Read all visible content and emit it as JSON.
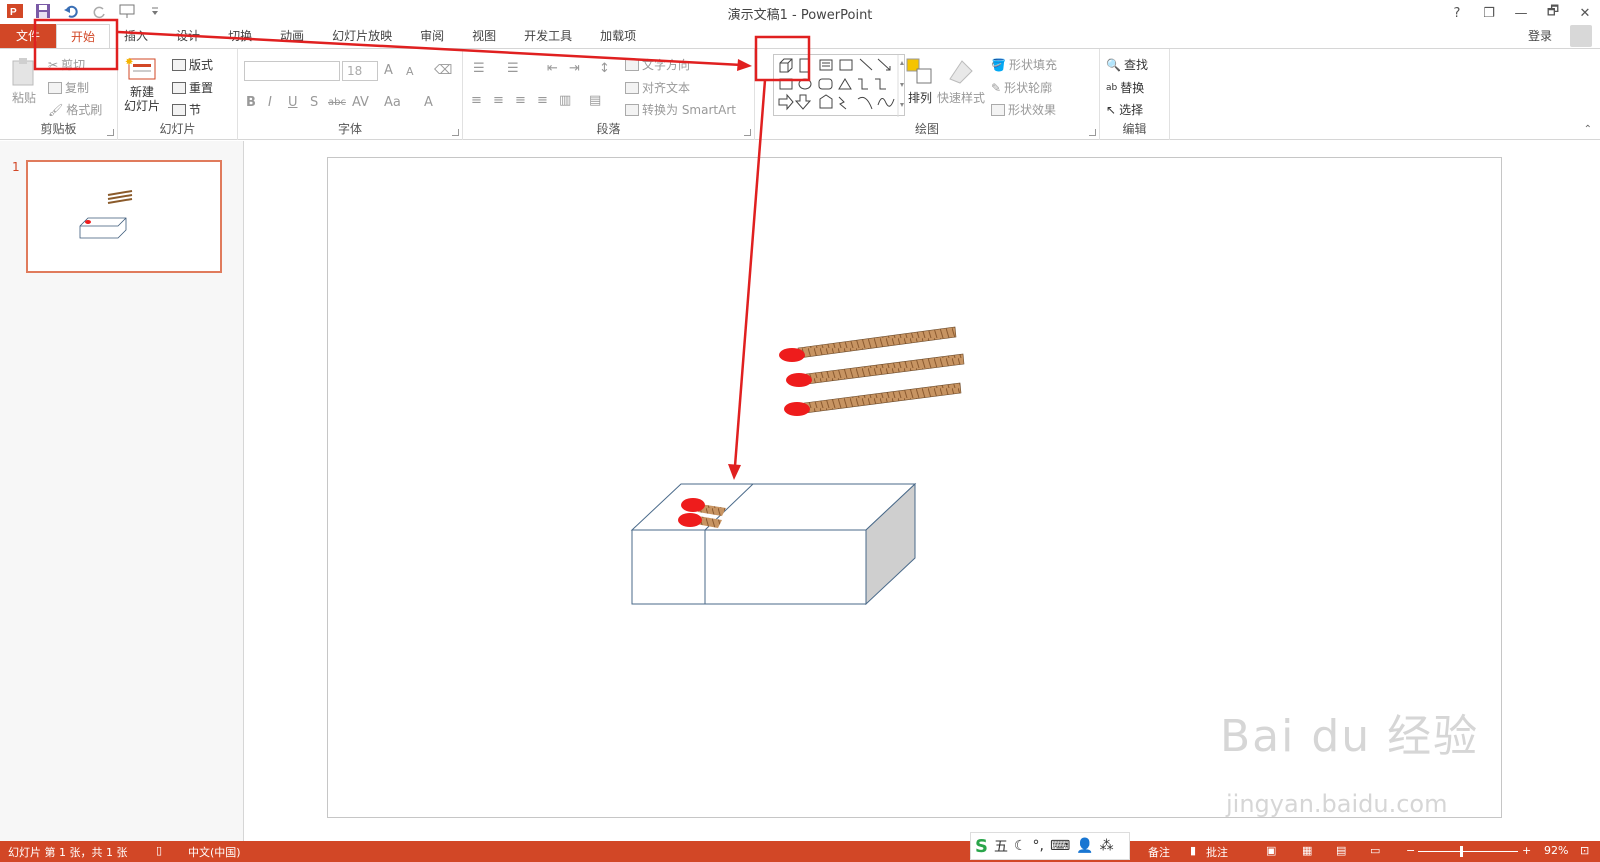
{
  "window": {
    "title": "演示文稿1 - PowerPoint"
  },
  "qat": {
    "icons": [
      "powerpoint-logo-icon",
      "save-icon",
      "undo-icon",
      "redo-icon",
      "presentation-icon",
      "customize-qat-icon"
    ]
  },
  "controls": {
    "help": "?",
    "restore": "❐",
    "minimize": "—",
    "maximize": "🗗",
    "close": "✕"
  },
  "tabs": [
    "文件",
    "开始",
    "插入",
    "设计",
    "切换",
    "动画",
    "幻灯片放映",
    "审阅",
    "视图",
    "开发工具",
    "加载项"
  ],
  "account": {
    "login": "登录"
  },
  "ribbon": {
    "clipboard": {
      "label": "剪贴板",
      "paste": "粘贴",
      "cut": "剪切",
      "copy": "复制",
      "format_painter": "格式刷"
    },
    "slides": {
      "label": "幻灯片",
      "new_slide_1": "新建",
      "new_slide_2": "幻灯片",
      "layout": "版式",
      "reset": "重置",
      "section": "节"
    },
    "font": {
      "label": "字体",
      "font_size": "18",
      "bold": "B",
      "italic": "I",
      "underline": "U",
      "shadow": "S",
      "strikethrough": "abc",
      "spacing": "AV",
      "case": "Aa",
      "color": "A",
      "grow": "A",
      "shrink": "A"
    },
    "paragraph": {
      "label": "段落",
      "text_direction": "文字方向",
      "align_text": "对齐文本",
      "smartart": "转换为 SmartArt"
    },
    "drawing": {
      "label": "绘图",
      "arrange": "排列",
      "quick_styles": "快速样式",
      "shape_fill": "形状填充",
      "shape_outline": "形状轮廓",
      "shape_effects": "形状效果"
    },
    "editing": {
      "label": "编辑",
      "find": "查找",
      "replace": "替换",
      "select": "选择"
    }
  },
  "thumbnail": {
    "number": "1"
  },
  "statusbar": {
    "slide_info": "幻灯片 第 1 张，共 1 张",
    "language": "中文(中国)",
    "notes": "备注",
    "comments": "批注",
    "zoom_out": "−",
    "zoom_in": "+",
    "zoom": "92%"
  },
  "ime": {
    "logo": "S",
    "mode": "五"
  },
  "watermark": {
    "main": "Bai du 经验",
    "url": "jingyan.baidu.com"
  },
  "colors": {
    "accent": "#d24726",
    "annotation": "#e02020",
    "match_head": "#ee1c1c",
    "match_stick": "#b07a4c"
  }
}
